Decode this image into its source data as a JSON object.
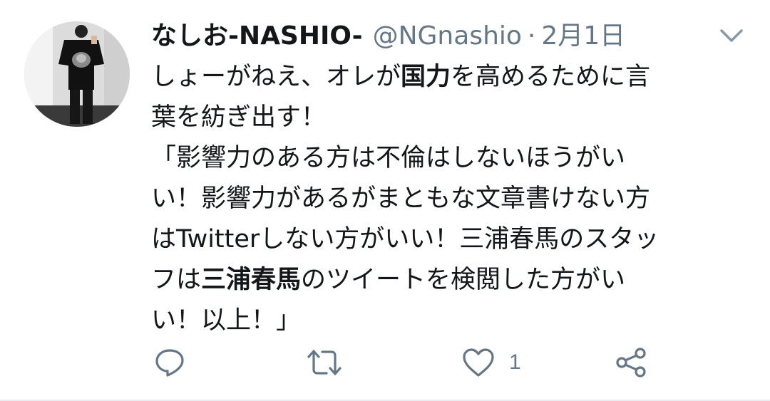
{
  "tweet": {
    "display_name": "なしお-NASHIO-",
    "handle": "@NGnashio",
    "separator": "·",
    "date": "2月1日",
    "avatar_icon": "avatar-person-photo",
    "caret_icon": "chevron-down-icon",
    "body": {
      "line1_a": "しょーがねえ、オレが",
      "line1_b": "国力",
      "line1_c": "を高めるために言",
      "line2": "葉を紡ぎ出す！",
      "line3": "「影響力のある方は不倫はしないほうがい",
      "line4": "い！影響力があるがまともな文章書けない方",
      "line5": "はTwitterしない方がいい！三浦春馬のスタッ",
      "line6_a": "フは",
      "line6_b": "三浦春馬",
      "line6_c": "のツイートを検閲した方がい",
      "line7": "い！以上！」"
    },
    "actions": {
      "reply_icon": "reply-icon",
      "retweet_icon": "retweet-icon",
      "like_icon": "heart-icon",
      "like_count": "1",
      "share_icon": "share-icon"
    },
    "colors": {
      "text": "#14171a",
      "secondary": "#657786",
      "border": "#e6ecf0"
    }
  }
}
